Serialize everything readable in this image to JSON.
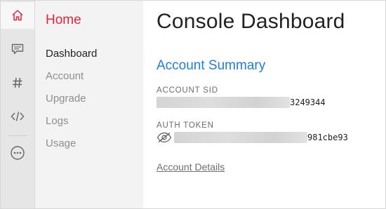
{
  "rail": {
    "icons": [
      "home-icon",
      "chat-icon",
      "hash-icon",
      "code-icon",
      "more-icon"
    ],
    "colors": {
      "active": "#e0243c",
      "inactive": "#666666"
    }
  },
  "subnav": {
    "title": "Home",
    "items": [
      {
        "label": "Dashboard",
        "active": true
      },
      {
        "label": "Account",
        "active": false
      },
      {
        "label": "Upgrade",
        "active": false
      },
      {
        "label": "Logs",
        "active": false
      },
      {
        "label": "Usage",
        "active": false
      }
    ]
  },
  "main": {
    "title": "Console Dashboard",
    "section_title": "Account Summary",
    "account_sid": {
      "label": "ACCOUNT SID",
      "visible_suffix": "3249344"
    },
    "auth_token": {
      "label": "AUTH TOKEN",
      "visible_suffix": "981cbe93",
      "toggle_icon": "eye-slash-icon"
    },
    "details_link": "Account Details"
  },
  "colors": {
    "brand_red": "#e0243c",
    "link_blue": "#1f7ee0"
  }
}
